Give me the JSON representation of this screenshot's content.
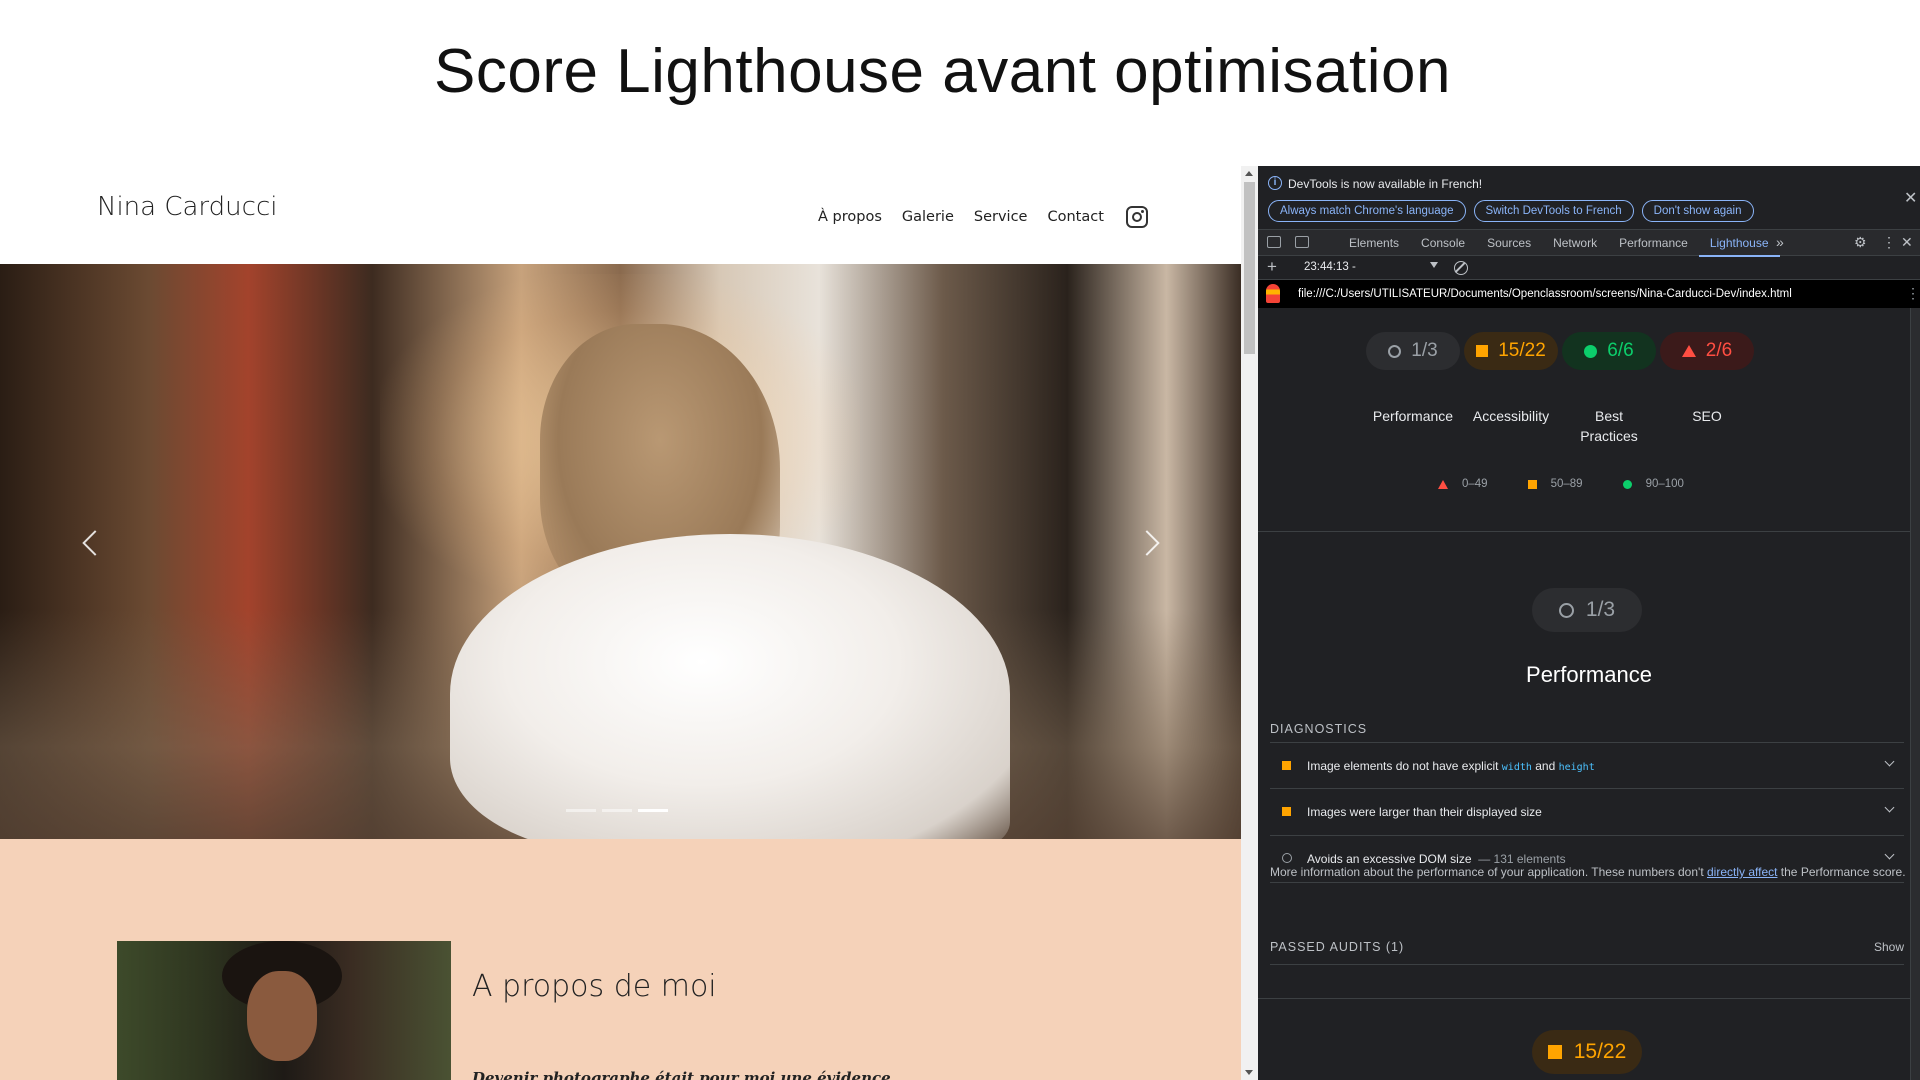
{
  "slide": {
    "title": "Score Lighthouse avant optimisation"
  },
  "site": {
    "logo": "Nina Carducci",
    "nav": [
      "À propos",
      "Galerie",
      "Service",
      "Contact"
    ],
    "about_title": "A propos de moi",
    "about_text": "Devenir photographe était pour moi une évidence."
  },
  "devtools": {
    "infobar": {
      "message": "DevTools is now available in French!",
      "buttons": [
        "Always match Chrome's language",
        "Switch DevTools to French",
        "Don't show again"
      ]
    },
    "tabs": [
      "Elements",
      "Console",
      "Sources",
      "Network",
      "Performance",
      "Lighthouse"
    ],
    "active_tab": "Lighthouse",
    "report_time": "23:44:13 -",
    "url": "file:///C:/Users/UTILISATEUR/Documents/Openclassroom/screens/Nina-Carducci-Dev/index.html",
    "scores": [
      {
        "value": "1/3",
        "label": "Performance",
        "status": "neutral"
      },
      {
        "value": "15/22",
        "label": "Accessibility",
        "status": "average"
      },
      {
        "value": "6/6",
        "label": "Best Practices",
        "status": "pass"
      },
      {
        "value": "2/6",
        "label": "SEO",
        "status": "fail"
      }
    ],
    "legend": {
      "fail": "0–49",
      "average": "50–89",
      "pass": "90–100"
    },
    "performance": {
      "score": "1/3",
      "title": "Performance",
      "diagnostics_heading": "DIAGNOSTICS",
      "audits": [
        {
          "text_before": "Image elements do not have explicit ",
          "code1": "width",
          "text_mid": " and ",
          "code2": "height"
        },
        {
          "text": "Images were larger than their displayed size"
        },
        {
          "text": "Avoids an excessive DOM size",
          "meta": "— 131 elements"
        }
      ],
      "more_info_before": "More information about the performance of your application. These numbers don't ",
      "more_info_link": "directly affect",
      "more_info_after": " the Performance score.",
      "passed_heading": "PASSED AUDITS (1)",
      "show_label": "Show"
    },
    "accessibility": {
      "score": "15/22"
    },
    "colors": {
      "accent": "#8ab4f8",
      "pass": "#0cce6b",
      "average": "#ffa400",
      "fail": "#ff4e42"
    }
  }
}
